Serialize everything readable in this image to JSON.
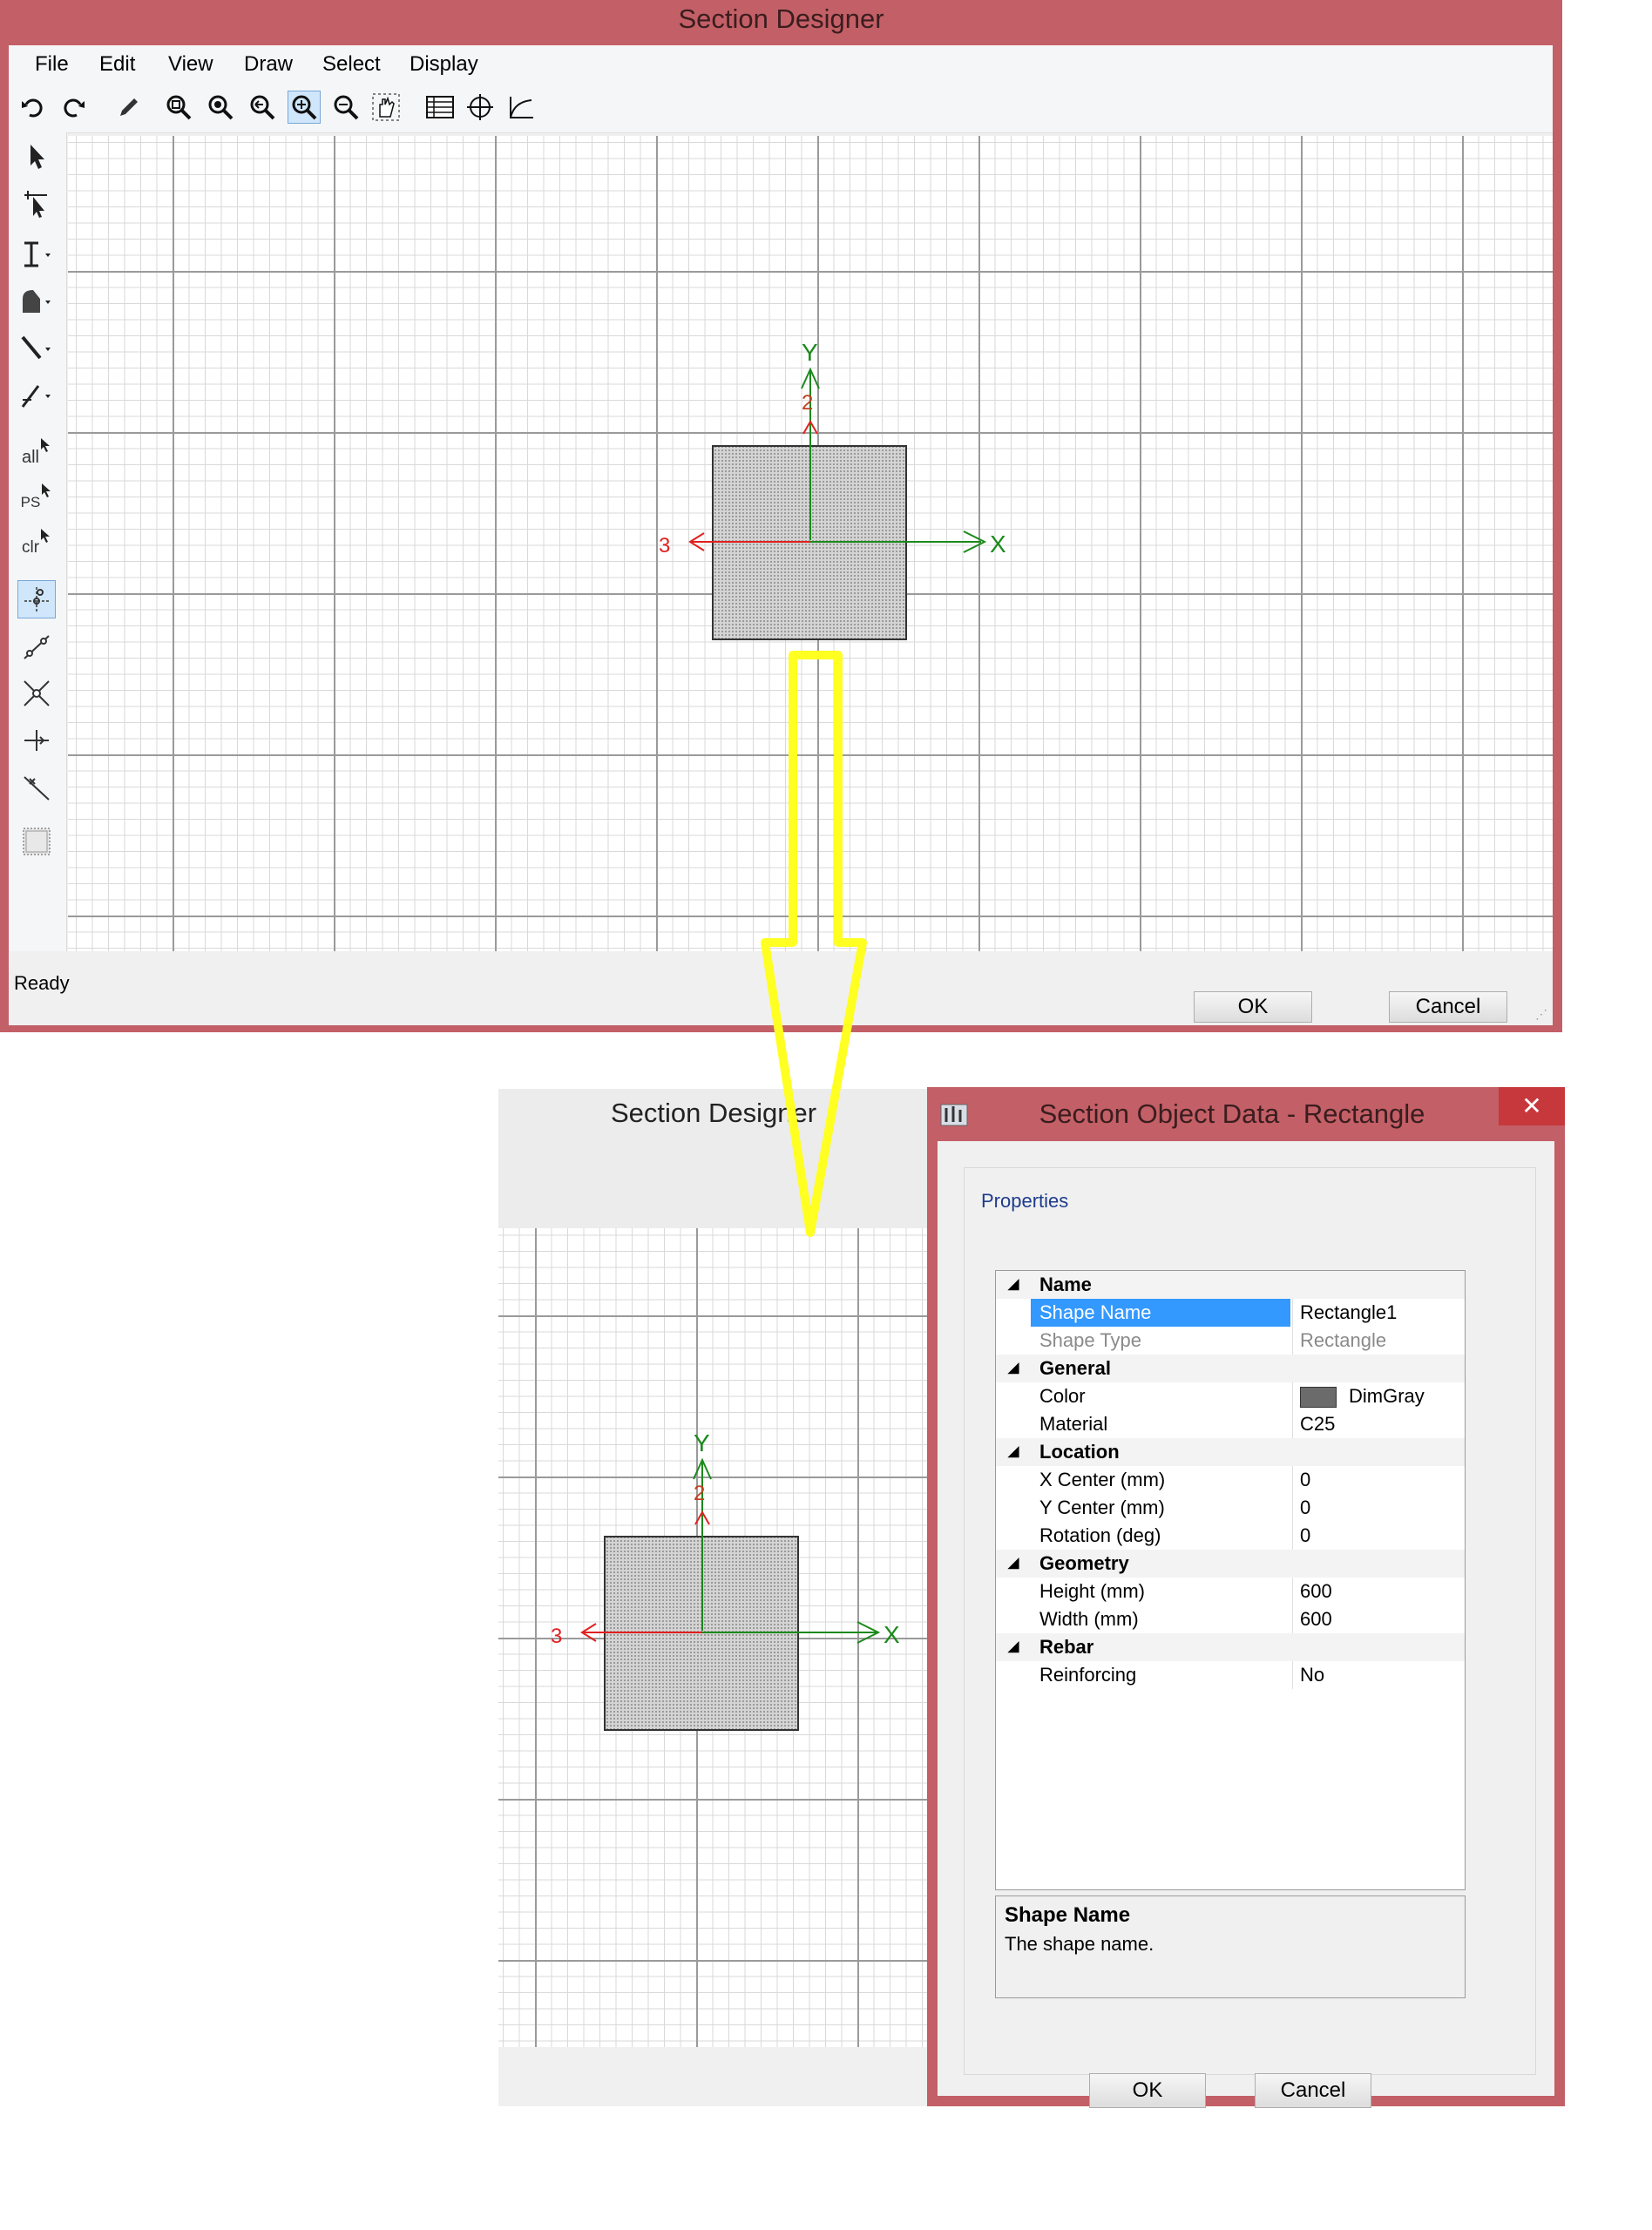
{
  "main_window": {
    "title": "Section Designer",
    "menu": [
      "File",
      "Edit",
      "View",
      "Draw",
      "Select",
      "Display"
    ],
    "status": "Ready",
    "ok_label": "OK",
    "cancel_label": "Cancel",
    "left_tool_labels": {
      "all": "all",
      "ps": "PS",
      "clr": "clr"
    }
  },
  "axes": {
    "y_label": "Y",
    "y_num": "2",
    "x_label": "X",
    "x_num": "3"
  },
  "second_window": {
    "title": "Section Designer"
  },
  "dialog": {
    "title": "Section Object Data - Rectangle",
    "close": "✕",
    "group_label": "Properties",
    "categories": [
      {
        "name": "Name",
        "rows": [
          {
            "label": "Shape Name",
            "value": "Rectangle1",
            "selected": true
          },
          {
            "label": "Shape Type",
            "value": "Rectangle",
            "disabled": true
          }
        ]
      },
      {
        "name": "General",
        "rows": [
          {
            "label": "Color",
            "value": "DimGray",
            "swatch": "#6b6b6b"
          },
          {
            "label": "Material",
            "value": "C25"
          }
        ]
      },
      {
        "name": "Location",
        "rows": [
          {
            "label": "X Center (mm)",
            "value": "0"
          },
          {
            "label": "Y Center (mm)",
            "value": "0"
          },
          {
            "label": "Rotation (deg)",
            "value": "0"
          }
        ]
      },
      {
        "name": "Geometry",
        "rows": [
          {
            "label": "Height (mm)",
            "value": "600"
          },
          {
            "label": "Width (mm)",
            "value": "600"
          }
        ]
      },
      {
        "name": "Rebar",
        "rows": [
          {
            "label": "Reinforcing",
            "value": "No"
          }
        ]
      }
    ],
    "desc_title": "Shape Name",
    "desc_text": "The shape name.",
    "ok_label": "OK",
    "cancel_label": "Cancel"
  },
  "colors": {
    "window_frame": "#c35f66",
    "arrow": "#ffff22",
    "axis_green": "#1c8a1c",
    "axis_red": "#e02020",
    "selection": "#3399ff"
  }
}
